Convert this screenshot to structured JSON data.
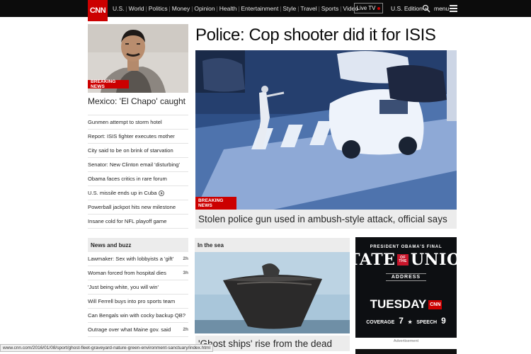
{
  "nav": {
    "logo": "CNN",
    "links": [
      "U.S.",
      "World",
      "Politics",
      "Money",
      "Opinion",
      "Health",
      "Entertainment",
      "Style",
      "Travel",
      "Sports",
      "Video"
    ],
    "live_tv": "Live TV",
    "edition": "U.S. Edition +",
    "menu": "menu",
    "accent": "#cc0000"
  },
  "lead": {
    "badge": "BREAKING NEWS",
    "title": "Mexico: 'El Chapo' caught"
  },
  "headlines": [
    "Gunmen attempt to storm hotel",
    "Report: ISIS fighter executes mother",
    "City said to be on brink of starvation",
    "Senator: New Clinton email 'disturbing'",
    "Obama faces critics in rare forum",
    "U.S. missile ends up in Cuba",
    "Powerball jackpot hits new milestone",
    "Insane cold for NFL playoff game"
  ],
  "main": {
    "title": "Police: Cop shooter did it for ISIS",
    "badge": "BREAKING NEWS",
    "caption": "Stolen police gun used in ambush-style attack, official says"
  },
  "buzz": {
    "heading": "News and buzz",
    "items": [
      {
        "text": "Lawmaker: Sex with lobbyists a 'gift'",
        "time": "2h"
      },
      {
        "text": "Woman forced from hospital dies",
        "time": "3h"
      },
      {
        "text": "'Just being white, you will win'",
        "time": ""
      },
      {
        "text": "Will Ferrell buys into pro sports team",
        "time": ""
      },
      {
        "text": "Can Bengals win with cocky backup QB?",
        "time": ""
      },
      {
        "text": "Outrage over what Maine gov. said",
        "time": "2h"
      }
    ]
  },
  "sea": {
    "heading": "In the sea",
    "caption": "'Ghost ships' rise from the dead"
  },
  "ad": {
    "pre": "PRESIDENT OBAMA'S FINAL",
    "state": "STATE",
    "of_the": "OF THE",
    "union": "UNION",
    "address": "ADDRESS",
    "day": "TUESDAY",
    "cnn": "CNN",
    "coverage": "COVERAGE",
    "coverage_time": "7",
    "speech": "SPEECH",
    "speech_time": "9",
    "label": "Advertisement"
  },
  "status_url": "www.cnn.com/2016/01/08/sport/ghost-fleet-graveyard-nature-green-environment-sanctuary/index.html"
}
